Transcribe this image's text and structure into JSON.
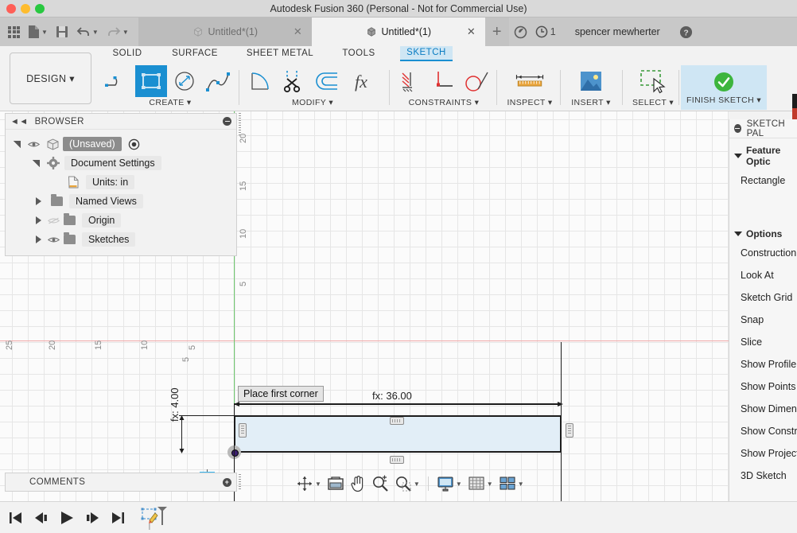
{
  "window": {
    "title": "Autodesk Fusion 360 (Personal - Not for Commercial Use)"
  },
  "quick_access": {
    "grid_label": "",
    "new_label": "",
    "save_label": "",
    "undo_label": "",
    "redo_label": ""
  },
  "tabs": [
    {
      "label": "Untitled*(1)",
      "active": false,
      "close": "✕"
    },
    {
      "label": "Untitled*(1)",
      "active": true,
      "close": "✕"
    }
  ],
  "tab_add": "+",
  "account": {
    "notification_count": "1",
    "username": "spencer mewherter",
    "help_label": "?"
  },
  "ribbon": {
    "design_menu": "DESIGN ▾",
    "workspace_tabs": [
      {
        "label": "SOLID",
        "active": false
      },
      {
        "label": "SURFACE",
        "active": false
      },
      {
        "label": "SHEET METAL",
        "active": false
      },
      {
        "label": "TOOLS",
        "active": false
      },
      {
        "label": "SKETCH",
        "active": true
      }
    ],
    "groups": [
      {
        "label": "CREATE ▾",
        "tools": [
          "line-tool",
          "rectangle-tool",
          "circle-tool",
          "spline-tool"
        ]
      },
      {
        "label": "MODIFY ▾",
        "tools": [
          "fillet-tool",
          "trim-tool",
          "offset-tool",
          "fx-tool"
        ]
      },
      {
        "label": "CONSTRAINTS ▾",
        "tools": [
          "fix-constraint",
          "perpendicular-constraint",
          "tangent-constraint"
        ]
      },
      {
        "label": "INSPECT ▾",
        "tools": [
          "measure-tool"
        ]
      },
      {
        "label": "INSERT ▾",
        "tools": [
          "insert-image-tool"
        ]
      },
      {
        "label": "SELECT ▾",
        "tools": [
          "select-tool"
        ]
      }
    ],
    "finish_sketch": "FINISH SKETCH ▾"
  },
  "browser": {
    "title": "BROWSER",
    "items": [
      {
        "label": "(Unsaved)",
        "indent": 0,
        "selected": true,
        "expander": "open",
        "eye": true,
        "icon": "cube-icon",
        "radio": true
      },
      {
        "label": "Document Settings",
        "indent": 1,
        "selected": false,
        "expander": "open",
        "eye": false,
        "icon": "gear-icon",
        "radio": false
      },
      {
        "label": "Units: in",
        "indent": 2,
        "selected": false,
        "expander": "none",
        "eye": false,
        "icon": "document-icon",
        "radio": false
      },
      {
        "label": "Named Views",
        "indent": 1,
        "selected": false,
        "expander": "closed",
        "eye": false,
        "icon": "folder-icon",
        "radio": false
      },
      {
        "label": "Origin",
        "indent": 1,
        "selected": false,
        "expander": "closed",
        "eye": "hidden",
        "icon": "folder-icon",
        "radio": false
      },
      {
        "label": "Sketches",
        "indent": 1,
        "selected": false,
        "expander": "closed",
        "eye": true,
        "icon": "folder-icon",
        "radio": false
      }
    ]
  },
  "comments": {
    "title": "COMMENTS",
    "add_label": "+"
  },
  "palette": {
    "title": "SKETCH PAL",
    "sections": [
      {
        "label": "Feature Optic",
        "items": [
          "Rectangle"
        ]
      },
      {
        "label": "Options",
        "items": [
          "Construction",
          "Look At",
          "Sketch Grid",
          "Snap",
          "Slice",
          "Show Profile",
          "Show Points",
          "Show Dimensi",
          "Show Constrai",
          "Show Projecte",
          "3D Sketch"
        ]
      }
    ]
  },
  "canvas": {
    "tooltip": "Place first corner",
    "dimension_horizontal": "fx: 36.00",
    "dimension_vertical": "fx: 4.00",
    "ruler_x_ticks": [
      "25",
      "20",
      "15",
      "10",
      "5"
    ],
    "ruler_y_ticks": [
      "20",
      "15",
      "10",
      "5"
    ],
    "colors": {
      "profile_fill": "#e2eef7",
      "profile_stroke": "#1d1d1d",
      "x_axis": "#f0a8a8",
      "y_axis": "#6ec96e",
      "grid": "#e6e6e6",
      "accent": "#1a8fd1"
    }
  },
  "nav_toolbar": {
    "buttons": [
      "orbit-icon",
      "look-at-icon",
      "pan-icon",
      "zoom-icon",
      "fit-icon",
      "display-settings-icon",
      "grid-settings-icon",
      "viewports-icon"
    ]
  },
  "timeline": {
    "buttons": [
      "go-to-beginning-icon",
      "step-back-icon",
      "play-icon",
      "step-forward-icon",
      "go-to-end-icon"
    ],
    "features": [
      "sketch-feature-marker"
    ]
  }
}
